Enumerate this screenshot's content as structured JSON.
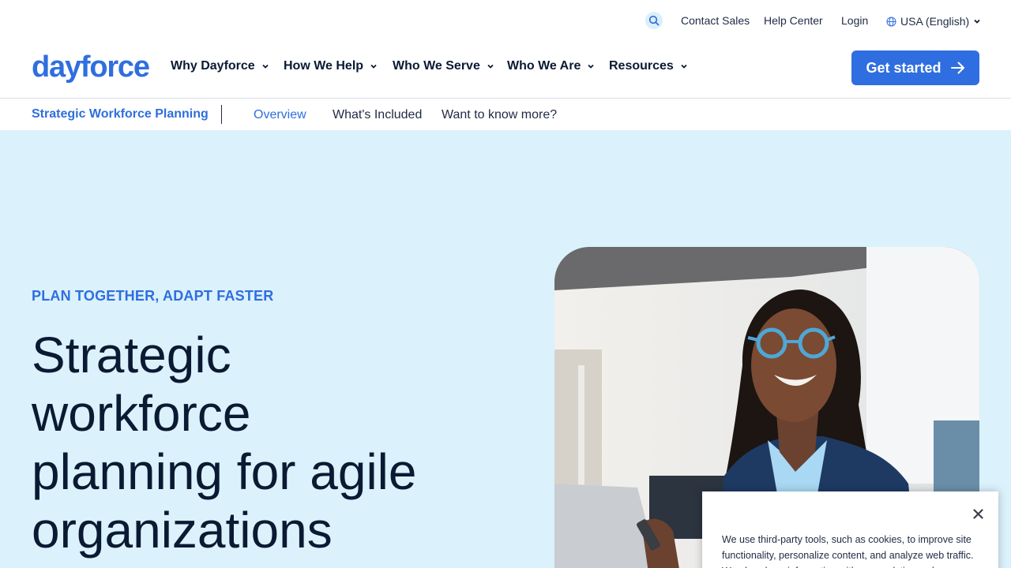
{
  "utility": {
    "search_icon": "search-icon",
    "contact_sales": "Contact Sales",
    "help_center": "Help Center",
    "login": "Login",
    "language": "USA (English)"
  },
  "nav": {
    "logo": "dayforce",
    "items": [
      {
        "label": "Why Dayforce"
      },
      {
        "label": "How We Help"
      },
      {
        "label": "Who We Serve"
      },
      {
        "label": "Who We Are"
      },
      {
        "label": "Resources"
      }
    ],
    "cta": "Get started"
  },
  "subnav": {
    "title": "Strategic Workforce Planning",
    "links": [
      {
        "label": "Overview",
        "active": true
      },
      {
        "label": "What's Included",
        "active": false
      },
      {
        "label": "Want to know more?",
        "active": false
      }
    ]
  },
  "hero": {
    "eyebrow": "PLAN TOGETHER, ADAPT FASTER",
    "headline_lines": [
      "Strategic",
      "workforce",
      "planning for agile",
      "organizations"
    ]
  },
  "cookie": {
    "text": "We use third-party tools, such as cookies, to improve site functionality, personalize content, and analyze web traffic. We also share information with our analytics and"
  },
  "colors": {
    "brand": "#2f6ee0",
    "hero_bg": "#dbf1fb",
    "text_dark": "#0b1a33"
  }
}
